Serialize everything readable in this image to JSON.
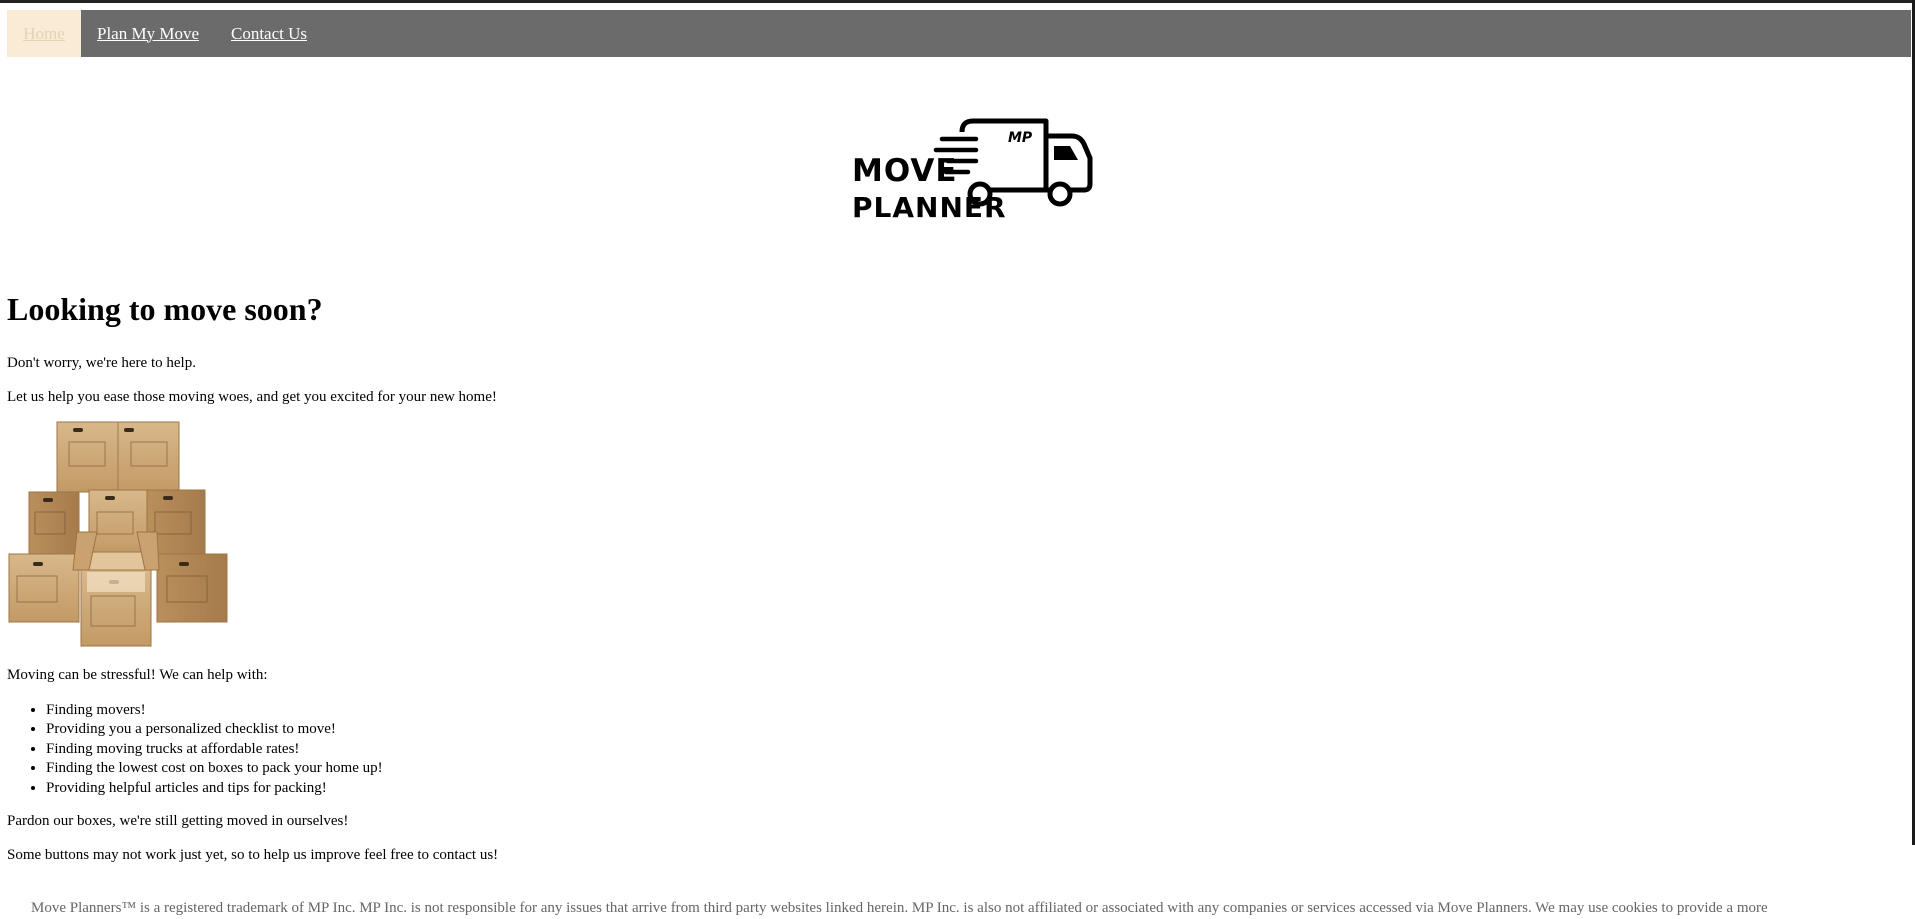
{
  "nav": {
    "items": [
      {
        "label": "Home",
        "active": true
      },
      {
        "label": "Plan My Move",
        "active": false
      },
      {
        "label": "Contact Us",
        "active": false
      }
    ]
  },
  "logo": {
    "badge": "MP",
    "line1": "Move",
    "line2": "Planner",
    "icon": "delivery-truck-icon"
  },
  "main": {
    "heading": "Looking to move soon?",
    "intro1": "Don't worry, we're here to help.",
    "intro2": "Let us help you ease those moving woes, and get you excited for your new home!",
    "image": "moving-boxes-image",
    "help_intro": "Moving can be stressful! We can help with:",
    "help_items": [
      "Finding movers!",
      "Providing you a personalized checklist to move!",
      "Finding moving trucks at affordable rates!",
      "Finding the lowest cost on boxes to pack your home up!",
      "Providing helpful articles and tips for packing!"
    ],
    "note1": "Pardon our boxes, we're still getting moved in ourselves!",
    "note2": "Some buttons may not work just yet, so to help us improve feel free to contact us!"
  },
  "footer": {
    "text": "Move Planners™ is a registered trademark of MP Inc. MP Inc. is not responsible for any issues that arrive from third party websites linked herein. MP Inc. is also not affiliated or associated with any companies or services accessed via Move Planners. We may use cookies to provide a more"
  },
  "colors": {
    "nav_bg": "#6b6b6b",
    "nav_active_bg": "#faebd7",
    "footer_text": "#666666"
  }
}
